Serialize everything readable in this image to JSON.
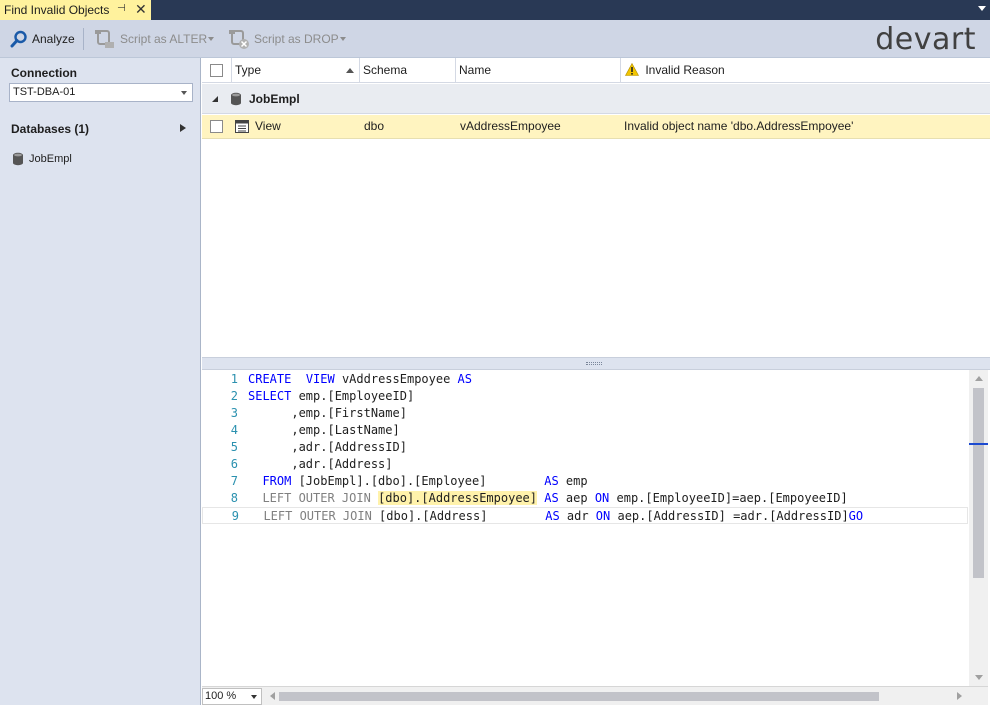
{
  "tab": {
    "title": "Find Invalid Objects",
    "pin_glyph": "⊣",
    "close_glyph": "✕"
  },
  "toolbar": {
    "analyze_label": "Analyze",
    "alter_label": "Script as ALTER",
    "drop_label": "Script as DROP",
    "logo": "devart"
  },
  "left_panel": {
    "connection_label": "Connection",
    "connection_value": "TST-DBA-01",
    "databases_label": "Databases  (1)",
    "databases": [
      "JobEmpl"
    ]
  },
  "grid": {
    "columns": [
      "Type",
      "Schema",
      "Name",
      "Invalid Reason"
    ],
    "group": "JobEmpl",
    "rows": [
      {
        "type": "View",
        "schema": "dbo",
        "name": "vAddressEmpoyee",
        "reason": "Invalid object name 'dbo.AddressEmpoyee'"
      }
    ]
  },
  "editor": {
    "lines": [
      {
        "n": "1",
        "parts": [
          [
            "kw",
            "CREATE"
          ],
          [
            "",
            "  "
          ],
          [
            "kw",
            "VIEW"
          ],
          [
            "",
            " vAddressEmpoyee "
          ],
          [
            "kw",
            "AS"
          ]
        ]
      },
      {
        "n": "2",
        "parts": [
          [
            "kw",
            "SELECT"
          ],
          [
            "",
            " emp.[EmployeeID]"
          ]
        ]
      },
      {
        "n": "3",
        "parts": [
          [
            "",
            "      ,emp.[FirstName]"
          ]
        ]
      },
      {
        "n": "4",
        "parts": [
          [
            "",
            "      ,emp.[LastName]"
          ]
        ]
      },
      {
        "n": "5",
        "parts": [
          [
            "",
            "      ,adr.[AddressID]"
          ]
        ]
      },
      {
        "n": "6",
        "parts": [
          [
            "",
            "      ,adr.[Address]"
          ]
        ]
      },
      {
        "n": "7",
        "parts": [
          [
            "",
            "  "
          ],
          [
            "kw",
            "FROM"
          ],
          [
            "",
            " [JobEmpl].[dbo].[Employee]        "
          ],
          [
            "kw",
            "AS"
          ],
          [
            "",
            " emp"
          ]
        ]
      },
      {
        "n": "8",
        "parts": [
          [
            "",
            "  "
          ],
          [
            "kw-gray",
            "LEFT OUTER JOIN"
          ],
          [
            "",
            " "
          ],
          [
            "hl",
            "[dbo].[AddressEmpoyee]"
          ],
          [
            "",
            " "
          ],
          [
            "kw",
            "AS"
          ],
          [
            "",
            " aep "
          ],
          [
            "kw",
            "ON"
          ],
          [
            "",
            " emp.[EmployeeID]=aep.[EmpoyeeID]"
          ]
        ]
      },
      {
        "n": "9",
        "parts": [
          [
            "",
            "  "
          ],
          [
            "kw-gray",
            "LEFT OUTER JOIN"
          ],
          [
            "",
            " [dbo].[Address]        "
          ],
          [
            "kw",
            "AS"
          ],
          [
            "",
            " adr "
          ],
          [
            "kw",
            "ON"
          ],
          [
            "",
            " aep.[AddressID] =adr.[AddressID]"
          ],
          [
            "kw",
            "GO"
          ]
        ]
      }
    ],
    "zoom": "100 %"
  }
}
